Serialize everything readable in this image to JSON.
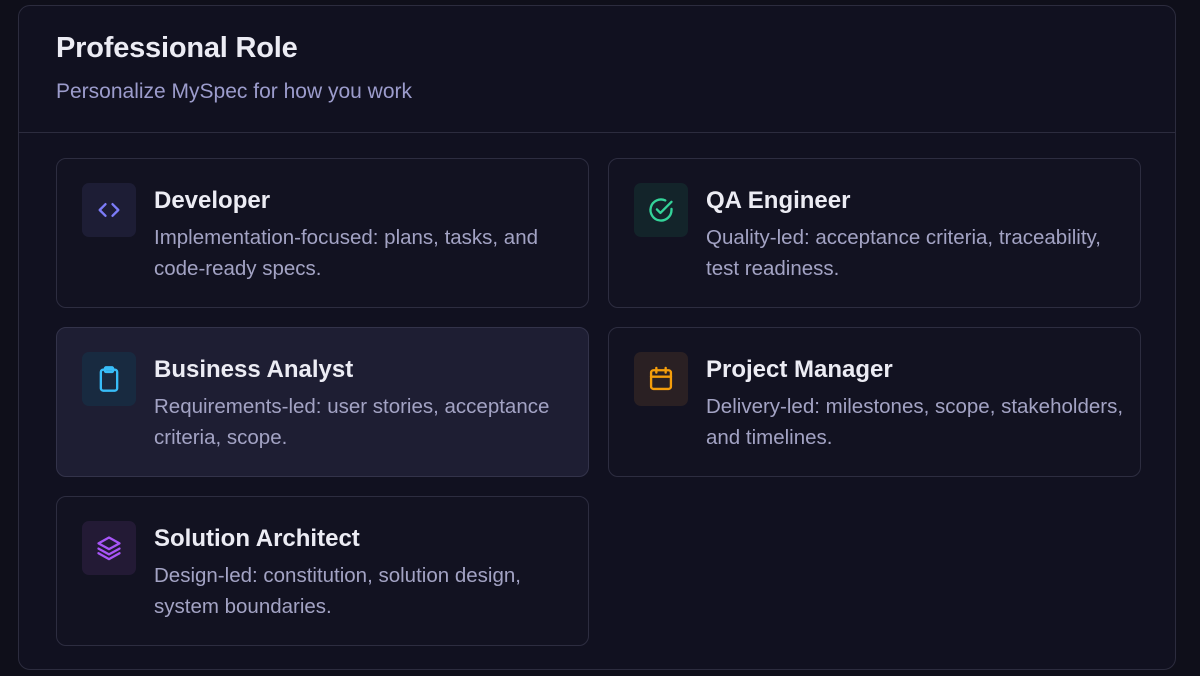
{
  "header": {
    "title": "Professional Role",
    "subtitle": "Personalize MySpec for how you work"
  },
  "roles": [
    {
      "title": "Developer",
      "description": "Implementation-focused: plans, tasks, and code-ready specs.",
      "icon": "code-icon",
      "icon_color": "#7c7cf8",
      "icon_bg": "#1d1d35",
      "selected": false
    },
    {
      "title": "QA Engineer",
      "description": "Quality-led: acceptance criteria, traceability, test readiness.",
      "icon": "check-circle-icon",
      "icon_color": "#34d399",
      "icon_bg": "#13242a",
      "selected": false
    },
    {
      "title": "Business Analyst",
      "description": "Requirements-led: user stories, acceptance criteria, scope.",
      "icon": "clipboard-icon",
      "icon_color": "#38bdf8",
      "icon_bg": "#182a40",
      "selected": true
    },
    {
      "title": "Project Manager",
      "description": "Delivery-led: milestones, scope, stakeholders, and timelines.",
      "icon": "calendar-icon",
      "icon_color": "#f59e0b",
      "icon_bg": "#2a2023",
      "selected": false
    },
    {
      "title": "Solution Architect",
      "description": "Design-led: constitution, solution design, system boundaries.",
      "icon": "layers-icon",
      "icon_color": "#a855f7",
      "icon_bg": "#231a35",
      "selected": false
    }
  ]
}
